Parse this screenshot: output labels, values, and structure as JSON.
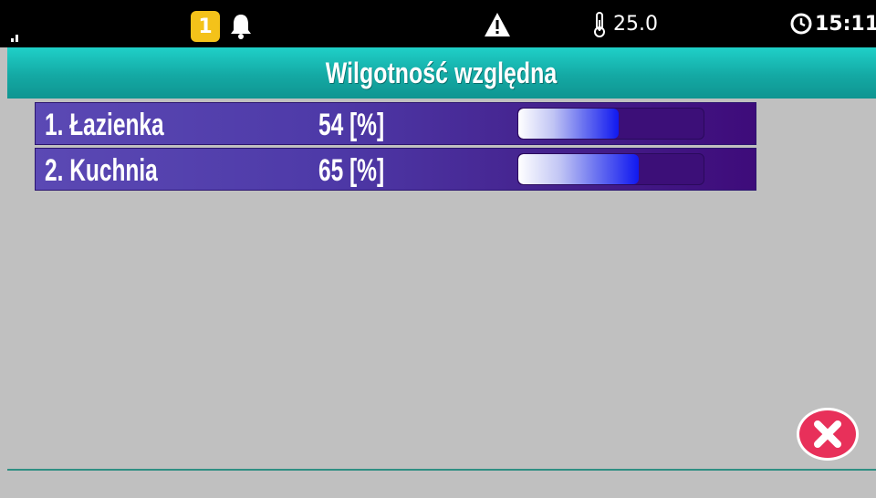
{
  "statusbar": {
    "alarm_count": "1",
    "temperature": "25.0",
    "time": "15:11",
    "icons": [
      "signal-icon",
      "alarm-count-badge",
      "bell-icon",
      "warning-icon",
      "thermometer-icon",
      "clock-icon"
    ]
  },
  "header": {
    "title": "Wilgotność względna"
  },
  "rows": [
    {
      "name": "1. Łazienka",
      "value": "54 [%]",
      "level": 0.54
    },
    {
      "name": "2. Kuchnia",
      "value": "65 [%]",
      "level": 0.65
    }
  ],
  "colors": {
    "titlebar": "#14a9a4",
    "row_bg": "#4e3aa8",
    "bar_fill": "#1018f0",
    "close_button": "#e8305a",
    "background": "#c0c0c0"
  },
  "actions": {
    "close_icon": "close-icon"
  }
}
